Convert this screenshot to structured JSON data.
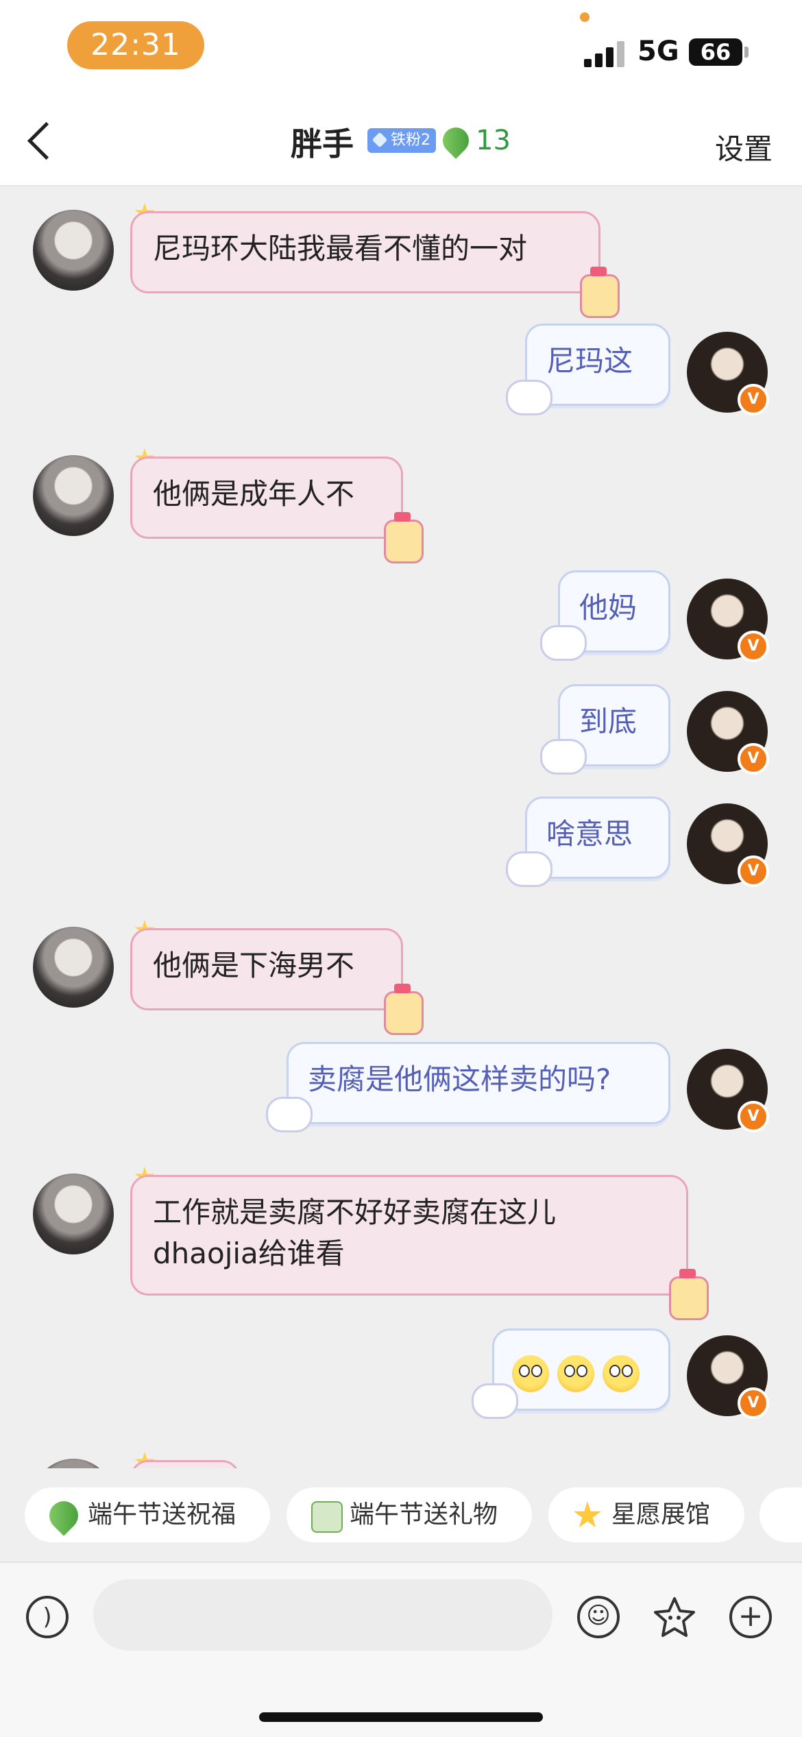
{
  "status_bar": {
    "time": "22:31",
    "network": "5G",
    "battery": "66"
  },
  "header": {
    "title": "胖手",
    "fan_badge": "铁粉2",
    "leaf_count": "13",
    "settings": "设置"
  },
  "messages": [
    {
      "side": "left",
      "text": "尼玛环大陆我最看不懂的一对"
    },
    {
      "side": "right",
      "text": "尼玛这"
    },
    {
      "side": "left",
      "text": "他俩是成年人不"
    },
    {
      "side": "right",
      "text": "他妈"
    },
    {
      "side": "right",
      "text": "到底"
    },
    {
      "side": "right",
      "text": "啥意思"
    },
    {
      "side": "left",
      "text": "他俩是下海男不"
    },
    {
      "side": "right",
      "text": "卖腐是他俩这样卖的吗?"
    },
    {
      "side": "left",
      "line1": "工作就是卖腐不好好卖腐在这儿",
      "line2": "dhaojia给谁看"
    },
    {
      "side": "right",
      "emoji": "flushed-face",
      "emoji_count": 3
    }
  ],
  "quick_actions": [
    {
      "label": "端午节送祝福",
      "icon": "zongzi-leaf-icon"
    },
    {
      "label": "端午节送礼物",
      "icon": "dragon-boat-gift-icon"
    },
    {
      "label": "星愿展馆",
      "icon": "star-icon"
    }
  ],
  "input_bar": {
    "voice_icon": "voice-icon",
    "emoji_icon": "smiley-icon",
    "gift_icon": "flower-icon",
    "more_icon": "plus-icon",
    "placeholder": ""
  },
  "colors": {
    "time_pill": "#f0a03a",
    "left_bubble_bg": "#f6e5ea",
    "left_bubble_border": "#eba5b8",
    "right_bubble_bg": "#f6f9ff",
    "right_text": "#5560b5",
    "verified_badge": "#f07c1a",
    "leaf_count": "#2e9a3d"
  }
}
